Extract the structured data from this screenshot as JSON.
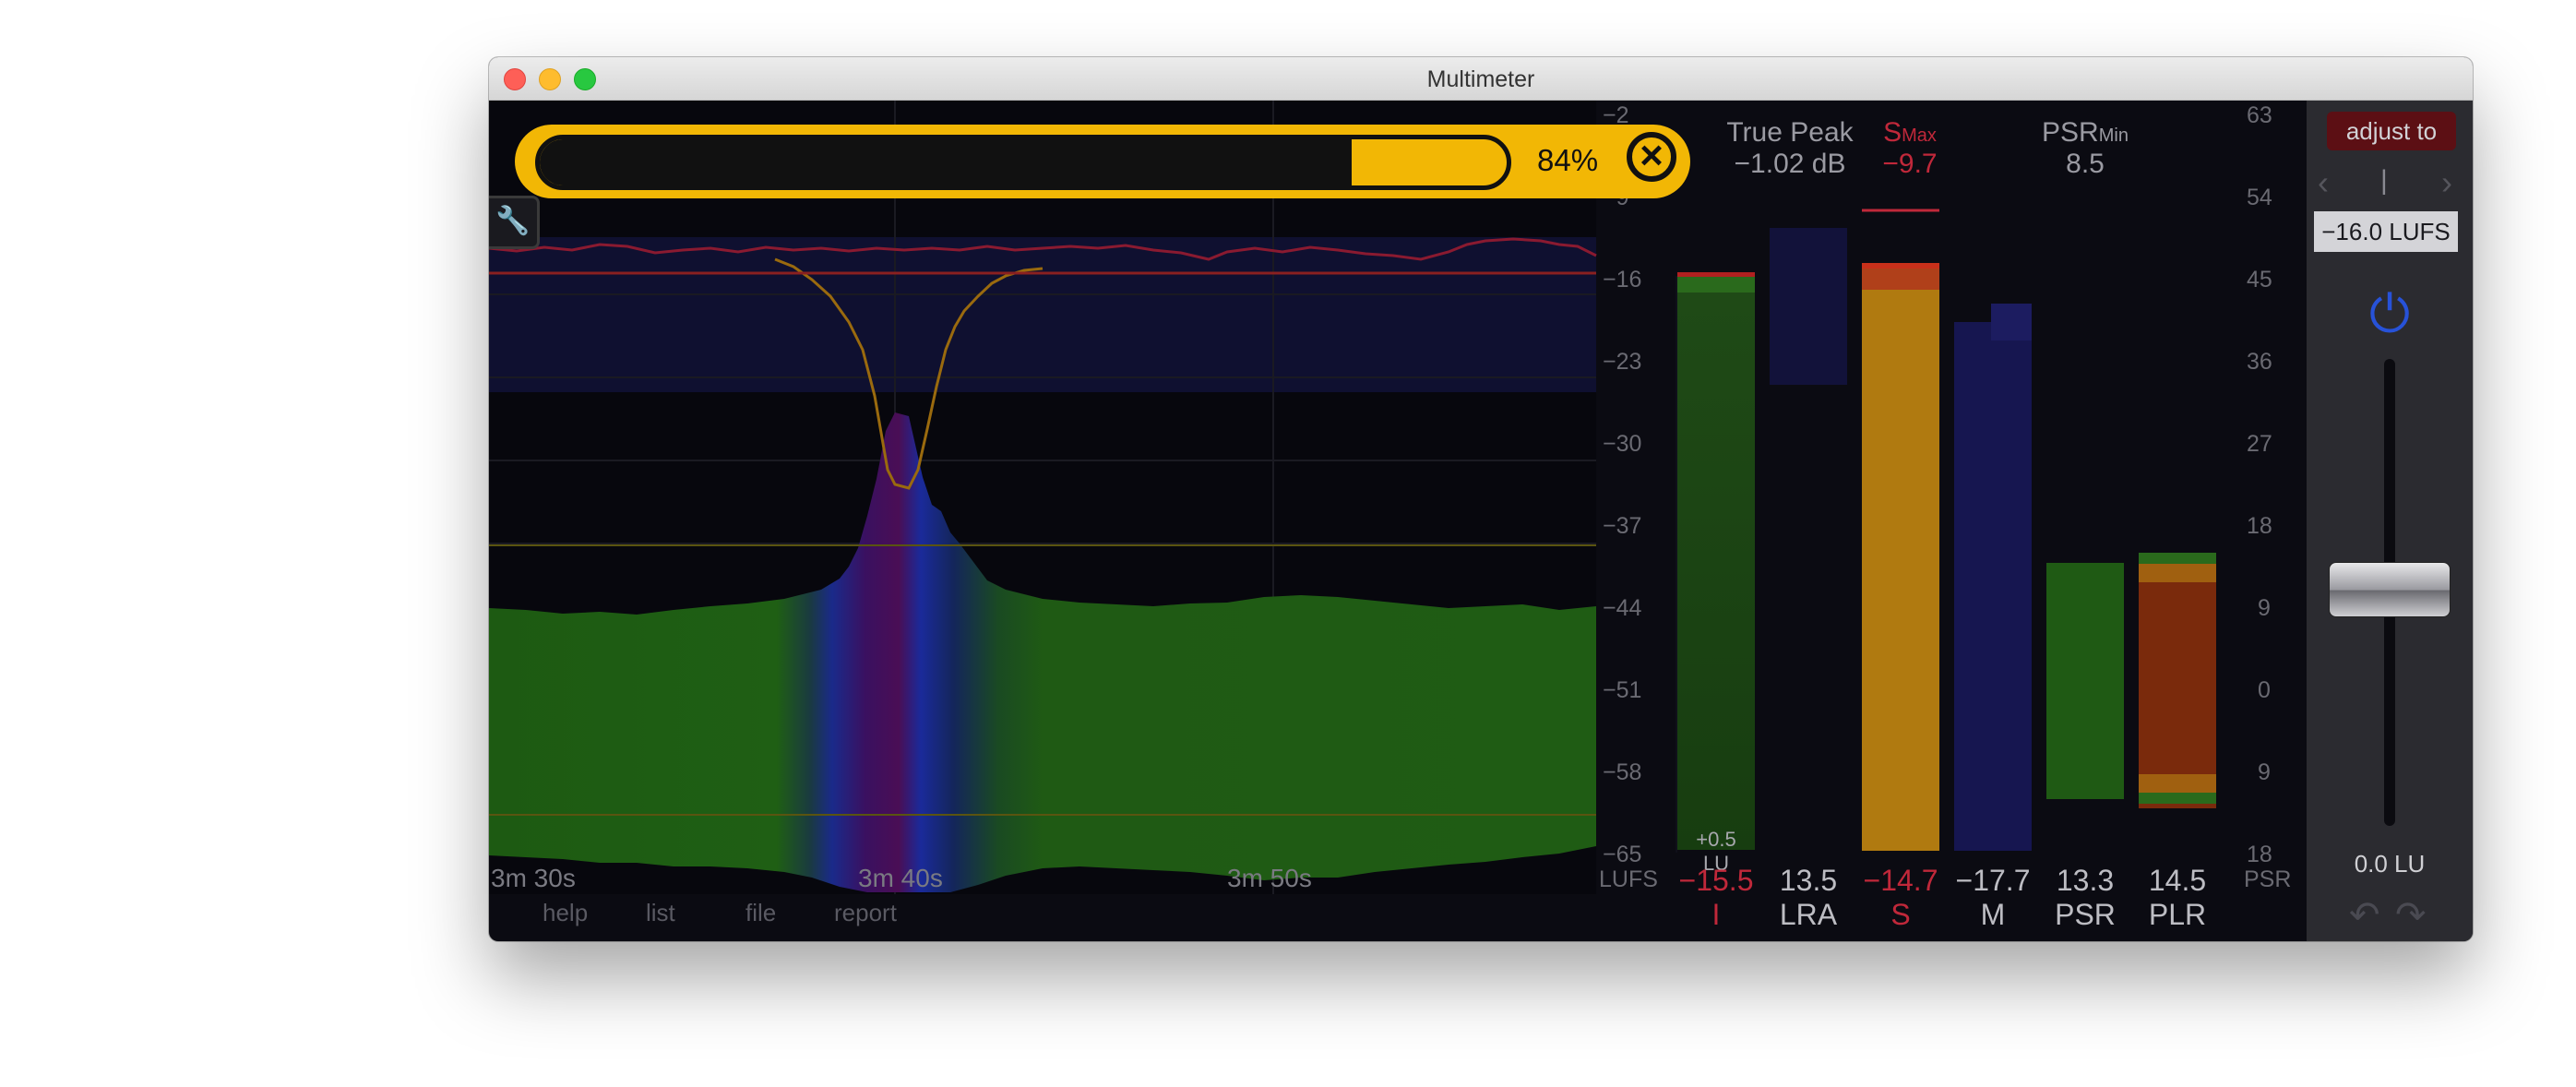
{
  "window": {
    "title": "Multimeter"
  },
  "progress": {
    "percent_label": "84%",
    "fraction": 0.84
  },
  "readouts": {
    "true_peak_label": "True Peak",
    "true_peak_value": "−1.02 dB",
    "smax_label": "S",
    "smax_sub": "Max",
    "smax_value": "−9.7",
    "psr_min_label": "PSR",
    "psr_min_sub": "Min",
    "psr_min_value": "8.5"
  },
  "timeline": {
    "labels": [
      "3m 30s",
      "3m 40s",
      "3m 50s"
    ]
  },
  "menu": [
    "help",
    "list",
    "file",
    "report"
  ],
  "lufs_scale": {
    "unit": "LUFS",
    "ticks": [
      "−2",
      "−9",
      "−16",
      "−23",
      "−30",
      "−37",
      "−44",
      "−51",
      "−58",
      "−65"
    ]
  },
  "psr_scale": {
    "unit": "PSR",
    "ticks": [
      "63",
      "54",
      "45",
      "36",
      "27",
      "18",
      "9",
      "0",
      "9",
      "18"
    ]
  },
  "meters": [
    {
      "id": "I",
      "label": "I",
      "value": "−15.5",
      "alert": true,
      "inner_label": "+0.5",
      "inner_unit": "LU"
    },
    {
      "id": "LRA",
      "label": "LRA",
      "value": "13.5",
      "alert": false
    },
    {
      "id": "S",
      "label": "S",
      "value": "−14.7",
      "alert": true
    },
    {
      "id": "M",
      "label": "M",
      "value": "−17.7",
      "alert": false
    },
    {
      "id": "PSR",
      "label": "PSR",
      "value": "13.3",
      "alert": false
    },
    {
      "id": "PLR",
      "label": "PLR",
      "value": "14.5",
      "alert": false
    }
  ],
  "side_panel": {
    "adjust_label": "adjust to",
    "preset_value": "|",
    "target": "−16.0 LUFS",
    "gain_readout": "0.0 LU",
    "icons": [
      "power-icon",
      "undo-icon",
      "redo-icon",
      "chevron-left-icon",
      "chevron-right-icon"
    ]
  },
  "colors": {
    "progress": "#f2b705",
    "alert": "#c0283a",
    "loudness_green": "#1f5a14",
    "short_term_orange": "#b07a10",
    "momentary_blue": "#1a1a50",
    "power_blue": "#2752d8"
  }
}
